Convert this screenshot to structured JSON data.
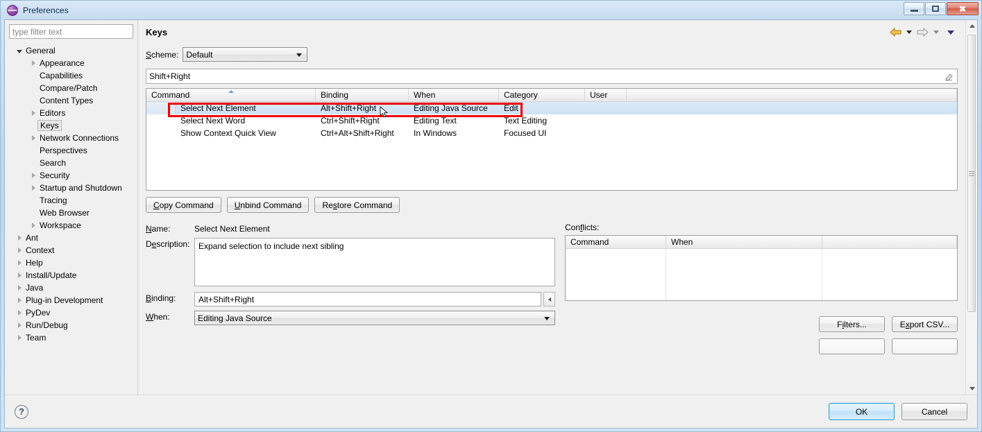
{
  "window": {
    "title": "Preferences",
    "icon": "preferences-orb-icon",
    "buttons": {
      "minimize": "minimize-icon",
      "maximize": "maximize-icon",
      "close": "✖"
    }
  },
  "sidebar": {
    "filter_placeholder": "type filter text",
    "items": [
      {
        "label": "General",
        "depth": 0,
        "twisty": "expanded",
        "selected": false
      },
      {
        "label": "Appearance",
        "depth": 1,
        "twisty": "collapsed",
        "selected": false
      },
      {
        "label": "Capabilities",
        "depth": 1,
        "twisty": "none",
        "selected": false
      },
      {
        "label": "Compare/Patch",
        "depth": 1,
        "twisty": "none",
        "selected": false
      },
      {
        "label": "Content Types",
        "depth": 1,
        "twisty": "none",
        "selected": false
      },
      {
        "label": "Editors",
        "depth": 1,
        "twisty": "collapsed",
        "selected": false
      },
      {
        "label": "Keys",
        "depth": 1,
        "twisty": "none",
        "selected": true
      },
      {
        "label": "Network Connections",
        "depth": 1,
        "twisty": "collapsed",
        "selected": false
      },
      {
        "label": "Perspectives",
        "depth": 1,
        "twisty": "none",
        "selected": false
      },
      {
        "label": "Search",
        "depth": 1,
        "twisty": "none",
        "selected": false
      },
      {
        "label": "Security",
        "depth": 1,
        "twisty": "collapsed",
        "selected": false
      },
      {
        "label": "Startup and Shutdown",
        "depth": 1,
        "twisty": "collapsed",
        "selected": false
      },
      {
        "label": "Tracing",
        "depth": 1,
        "twisty": "none",
        "selected": false
      },
      {
        "label": "Web Browser",
        "depth": 1,
        "twisty": "none",
        "selected": false
      },
      {
        "label": "Workspace",
        "depth": 1,
        "twisty": "collapsed",
        "selected": false
      },
      {
        "label": "Ant",
        "depth": 0,
        "twisty": "collapsed",
        "selected": false
      },
      {
        "label": "Context",
        "depth": 0,
        "twisty": "collapsed",
        "selected": false
      },
      {
        "label": "Help",
        "depth": 0,
        "twisty": "collapsed",
        "selected": false
      },
      {
        "label": "Install/Update",
        "depth": 0,
        "twisty": "collapsed",
        "selected": false
      },
      {
        "label": "Java",
        "depth": 0,
        "twisty": "collapsed",
        "selected": false
      },
      {
        "label": "Plug-in Development",
        "depth": 0,
        "twisty": "collapsed",
        "selected": false
      },
      {
        "label": "PyDev",
        "depth": 0,
        "twisty": "collapsed",
        "selected": false
      },
      {
        "label": "Run/Debug",
        "depth": 0,
        "twisty": "collapsed",
        "selected": false
      },
      {
        "label": "Team",
        "depth": 0,
        "twisty": "collapsed",
        "selected": false
      }
    ]
  },
  "page": {
    "title": "Keys",
    "nav": {
      "back_icon": "back-arrow-icon",
      "back_menu_icon": "chevron-down-icon",
      "forward_icon": "forward-arrow-icon",
      "forward_menu_icon": "chevron-down-icon",
      "view_menu_icon": "chevron-down-icon"
    },
    "scheme": {
      "label": "Scheme:",
      "label_mnemonic": "S",
      "value": "Default",
      "options": [
        "Default"
      ]
    },
    "search": {
      "value": "Shift+Right",
      "clear_icon": "eraser-icon"
    }
  },
  "bindings_table": {
    "columns": [
      "Command",
      "Binding",
      "When",
      "Category",
      "User"
    ],
    "sort_column": "Command",
    "sort_direction": "asc",
    "rows": [
      {
        "command": "Select Next Element",
        "binding": "Alt+Shift+Right",
        "when": "Editing Java Source",
        "category": "Edit",
        "user": "",
        "selected": true
      },
      {
        "command": "Select Next Word",
        "binding": "Ctrl+Shift+Right",
        "when": "Editing Text",
        "category": "Text Editing",
        "user": "",
        "selected": false
      },
      {
        "command": "Show Context Quick View",
        "binding": "Ctrl+Alt+Shift+Right",
        "when": "In Windows",
        "category": "Focused UI",
        "user": "",
        "selected": false
      }
    ]
  },
  "command_buttons": [
    {
      "label": "Copy Command",
      "mnemonic": "C"
    },
    {
      "label": "Unbind Command",
      "mnemonic": "U"
    },
    {
      "label": "Restore Command",
      "mnemonic": "s"
    }
  ],
  "details": {
    "name_label": "Name:",
    "name_value": "Select Next Element",
    "description_label": "Description:",
    "description_value": "Expand selection to include next sibling",
    "binding_label": "Binding:",
    "binding_value": "Alt+Shift+Right",
    "binding_side_icon": "caret-left-icon",
    "when_label": "When:",
    "when_value": "Editing Java Source",
    "when_options": [
      "Editing Java Source"
    ]
  },
  "conflicts": {
    "label": "Conflicts:",
    "columns": [
      "Command",
      "When",
      ""
    ],
    "rows": []
  },
  "panel_buttons": [
    {
      "label": "Filters...",
      "mnemonic": "i"
    },
    {
      "label": "Export CSV...",
      "mnemonic": "x"
    }
  ],
  "footer": {
    "help_icon": "help-question-icon",
    "ok_label": "OK",
    "cancel_label": "Cancel"
  },
  "colors": {
    "highlight_red": "#ef0000",
    "selection_blue": "#cfe2f5",
    "title_gradient": "#cfe3f5",
    "default_button_border": "#2e9fd9"
  }
}
